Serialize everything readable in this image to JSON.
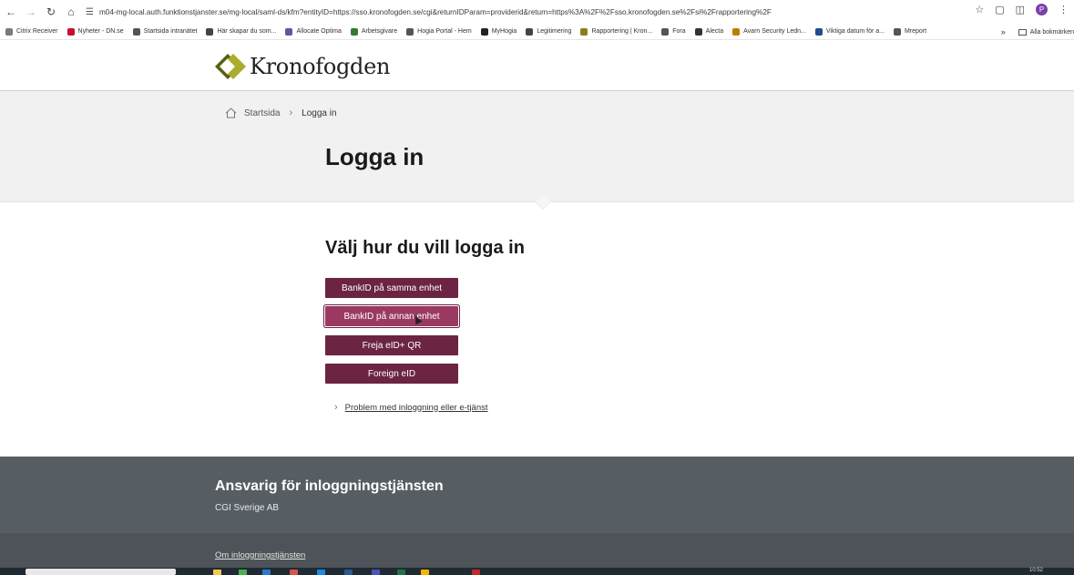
{
  "browser": {
    "url": "m04-mg-local.auth.funktionstjanster.se/mg-local/saml-ds/kfm?entityID=https://sso.kronofogden.se/cgi&returnIDParam=providerid&return=https%3A%2F%2Fsso.kronofogden.se%2Fsi%2Frapportering%2F",
    "profile_initial": "P",
    "bookmarks": [
      {
        "label": "Citrix Receiver",
        "color": "#7a7a7a"
      },
      {
        "label": "Nyheter - DN.se",
        "color": "#c8102e"
      },
      {
        "label": "Startsida intranätet",
        "color": "#555555"
      },
      {
        "label": "Här skapar du som...",
        "color": "#444444"
      },
      {
        "label": "Allocate Optima",
        "color": "#6b4fa0"
      },
      {
        "label": "Arbetsgivare",
        "color": "#2e7d32"
      },
      {
        "label": "Hogia Portal - Hem",
        "color": "#555555"
      },
      {
        "label": "MyHogia",
        "color": "#222222"
      },
      {
        "label": "Legitimering",
        "color": "#444444"
      },
      {
        "label": "Rapportering | Kron...",
        "color": "#8a7d1c"
      },
      {
        "label": "Fora",
        "color": "#555555"
      },
      {
        "label": "Alecta",
        "color": "#333333"
      },
      {
        "label": "Avarn Security Ledn...",
        "color": "#c47a00"
      },
      {
        "label": "Viktiga datum för a...",
        "color": "#1a4f8a"
      },
      {
        "label": "Mreport",
        "color": "#555555"
      }
    ],
    "all_bookmarks_label": "Alla bokmärken"
  },
  "header": {
    "logo_text": "Kronofogden",
    "brand_colors": {
      "dark": "#5a5f13",
      "light": "#a9ad2b"
    }
  },
  "breadcrumb": {
    "home": "Startsida",
    "current": "Logga in"
  },
  "page": {
    "title": "Logga in",
    "section_title": "Välj hur du vill logga in"
  },
  "login_options": [
    {
      "label": "BankID på samma enhet",
      "state": "normal"
    },
    {
      "label": "BankID på annan enhet",
      "state": "hover"
    },
    {
      "label": "Freja eID+ QR",
      "state": "normal"
    },
    {
      "label": "Foreign eID",
      "state": "normal"
    }
  ],
  "help_link": "Problem med inloggning eller e-tjänst",
  "footer": {
    "title": "Ansvarig för inloggningstjänsten",
    "organization": "CGI Sverige AB",
    "about_link": "Om inloggningstjänsten"
  },
  "colors": {
    "button": "#6b2442",
    "button_hover": "#9a3a63",
    "footer": "#575e63",
    "hero_bg": "#f1f1f1"
  },
  "taskbar": {
    "clock": "10:52"
  }
}
